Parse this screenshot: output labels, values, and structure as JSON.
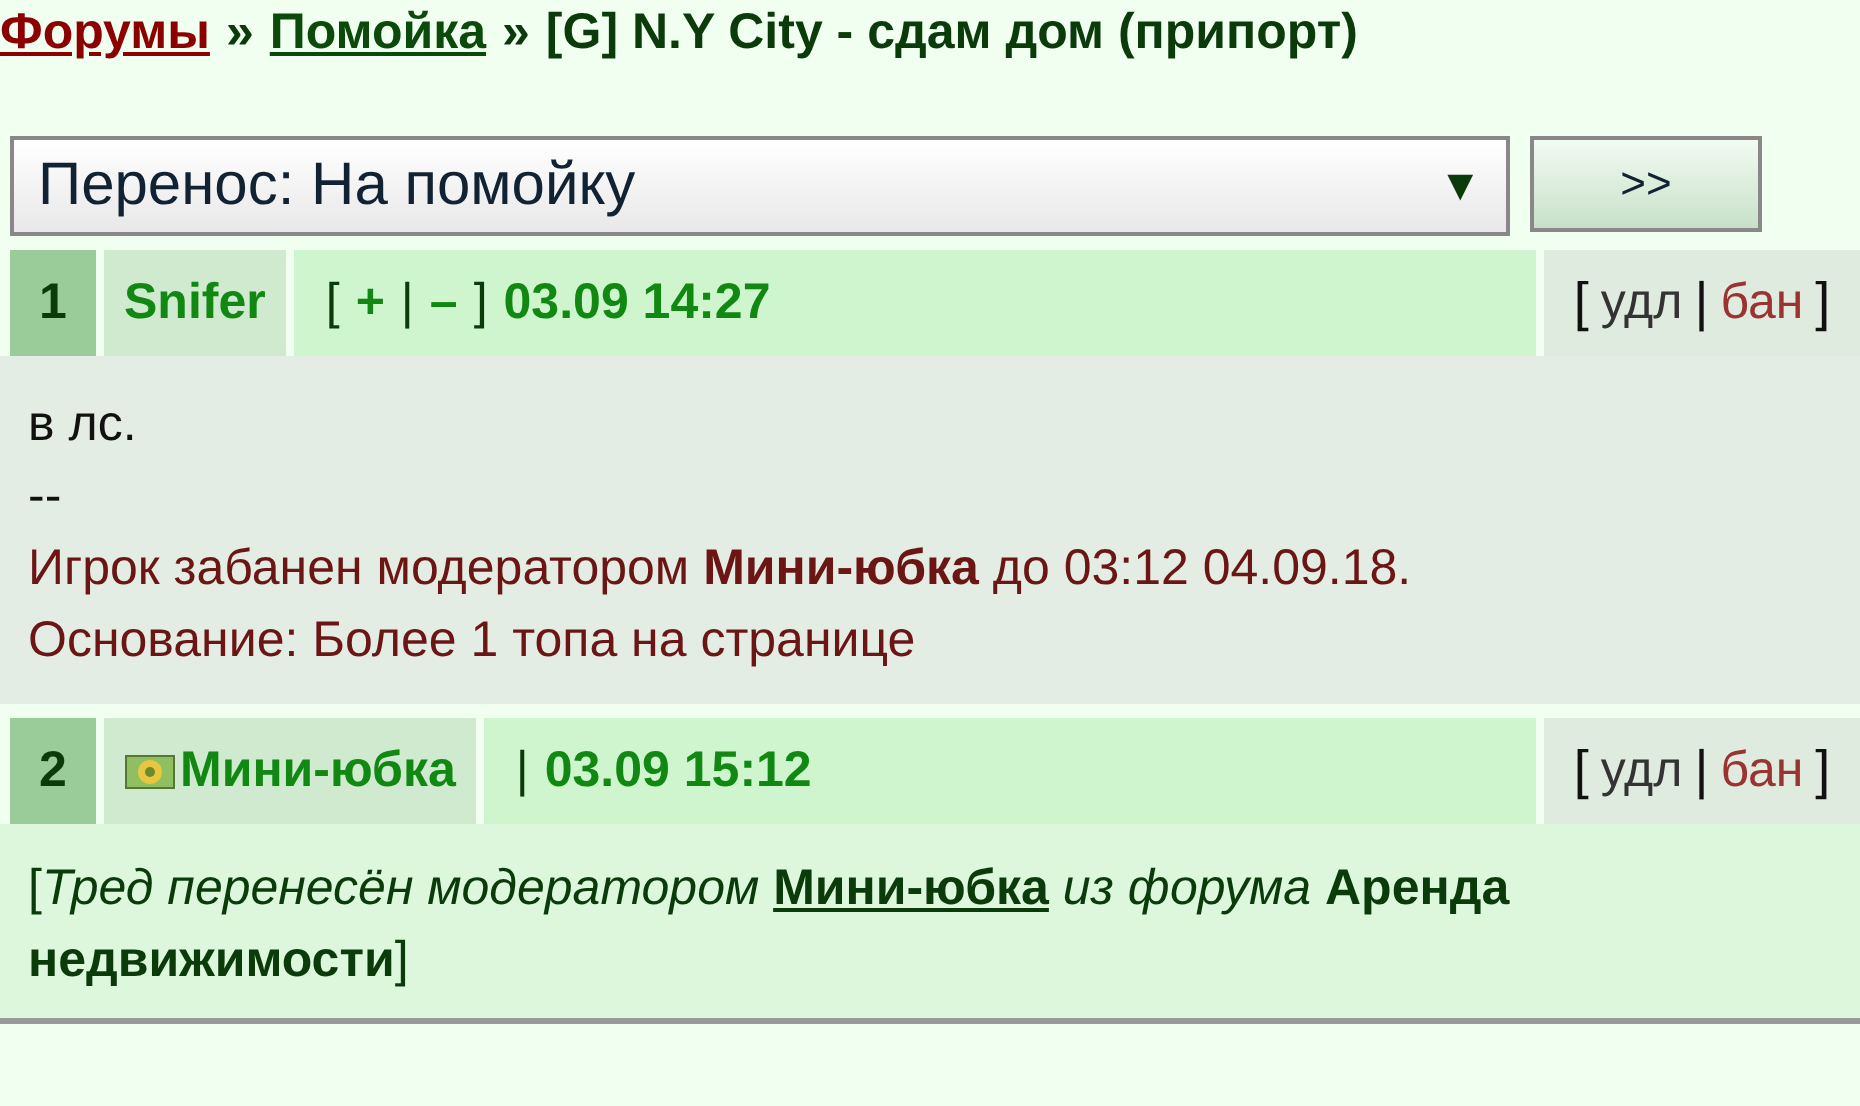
{
  "breadcrumb": [
    {
      "text": "Форумы",
      "kind": "link-root"
    },
    {
      "text": "»",
      "kind": "sep"
    },
    {
      "text": "Помойка",
      "kind": "link"
    },
    {
      "text": "»",
      "kind": "sep"
    },
    {
      "text": "[G] N.Y City - сдам дом (припорт)",
      "kind": "title"
    }
  ],
  "move": {
    "value": "Перенос: На помойку",
    "arrow": "▼",
    "button": ">>"
  },
  "posts": [
    {
      "number": "1",
      "author": "Snifer",
      "avatar": false,
      "meta": [
        {
          "text": "[",
          "kind": "punct"
        },
        {
          "text": "+",
          "kind": "link"
        },
        {
          "text": "|",
          "kind": "punct"
        },
        {
          "text": "–",
          "kind": "link"
        },
        {
          "text": "]",
          "kind": "punct"
        }
      ],
      "time": "03.09 14:27",
      "actions": [
        {
          "text": "[",
          "kind": "punct"
        },
        {
          "text": "удл",
          "kind": "action"
        },
        {
          "text": "|",
          "kind": "punct"
        },
        {
          "text": "бан",
          "kind": "danger"
        },
        {
          "text": "]",
          "kind": "punct"
        }
      ],
      "kind": "message",
      "lines": [
        {
          "text": "в лс.",
          "kind": "plain"
        },
        {
          "text": "--",
          "kind": "plain"
        },
        {
          "text": "Игрок забанен модератором **Мини-юбка** до 03:12 04.09.18.",
          "kind": "notice"
        },
        {
          "text": "Основание: Более 1 топа на странице",
          "kind": "notice"
        }
      ]
    },
    {
      "number": "2",
      "author": "Мини-юбка",
      "avatar": true,
      "meta": [
        {
          "text": "|",
          "kind": "punct"
        }
      ],
      "time": "03.09 15:12",
      "actions": [
        {
          "text": "[",
          "kind": "punct"
        },
        {
          "text": "удл",
          "kind": "action"
        },
        {
          "text": "|",
          "kind": "punct"
        },
        {
          "text": "бан",
          "kind": "danger"
        },
        {
          "text": "]",
          "kind": "punct"
        }
      ],
      "kind": "system",
      "parts": [
        {
          "text": "[",
          "kind": "plain"
        },
        {
          "text": "Тред перенесён модератором ",
          "kind": "italic"
        },
        {
          "text": "Мини-юбка",
          "kind": "link"
        },
        {
          "text": " из форума ",
          "kind": "italic"
        },
        {
          "text": "Аренда недвижимости",
          "kind": "bold"
        },
        {
          "text": "]",
          "kind": "plain"
        }
      ]
    }
  ]
}
